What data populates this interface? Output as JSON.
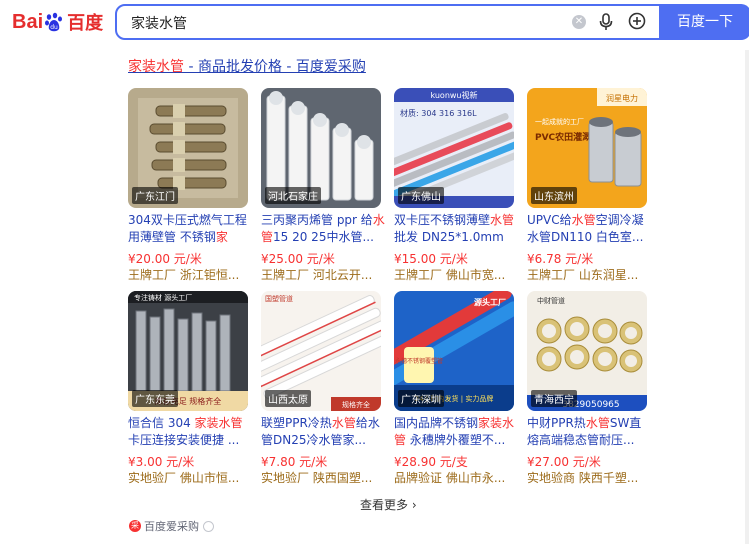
{
  "header": {
    "logo_text": "Bai",
    "logo_text_cn": "百度",
    "search_value": "家装水管",
    "search_button": "百度一下"
  },
  "result": {
    "title_highlight": "家装水管",
    "title_rest": " - 商品批发价格 - 百度爱采购"
  },
  "products": [
    {
      "location": "广东江门",
      "title_a": "304双卡压式燃气工程用薄壁管 不锈钢",
      "title_hl": "家",
      "title_b": "",
      "price": "¥20.00 元/米",
      "seller": "王牌工厂 浙江钜恒..."
    },
    {
      "location": "河北石家庄",
      "title_a": "三丙聚丙烯管 ppr 给",
      "title_hl": "水管",
      "title_b": "15 20 25中水管...",
      "price": "¥25.00 元/米",
      "seller": "王牌工厂 河北云开..."
    },
    {
      "location": "广东佛山",
      "title_a": "双卡压不锈钢薄壁",
      "title_hl": "水管",
      "title_b": "批发 DN25*1.0mm ...",
      "price": "¥15.00 元/米",
      "seller": "王牌工厂 佛山市宽..."
    },
    {
      "location": "山东滨州",
      "title_a": "UPVC给",
      "title_hl": "水管",
      "title_b": "空调冷凝水管DN110 白色室...",
      "price": "¥6.78 元/米",
      "seller": "王牌工厂 山东润星..."
    },
    {
      "location": "广东东莞",
      "title_a": "恒合信 304 ",
      "title_hl": "家装水管",
      "title_b": "卡压连接安装便捷 ...",
      "price": "¥3.00 元/米",
      "seller": "实地验厂 佛山市恒..."
    },
    {
      "location": "山西太原",
      "title_a": "联塑PPR冷热",
      "title_hl": "水管",
      "title_b": "给水管DN25冷水管家...",
      "price": "¥7.80 元/米",
      "seller": "实地验厂 陕西国塑..."
    },
    {
      "location": "广东深圳",
      "title_a": "国内品牌不锈钢",
      "title_hl": "家装水管",
      "title_b": " 永穗牌外覆塑不...",
      "price": "¥28.90 元/支",
      "seller": "品牌验证 佛山市永..."
    },
    {
      "location": "青海西宁",
      "title_a": "中财PPR热",
      "title_hl": "水管",
      "title_b": "SW直熔高端稳态管耐压...",
      "price": "¥27.00 元/米",
      "seller": "实地验商 陕西千塑..."
    }
  ],
  "more_label": "查看更多",
  "footer_label": "百度爱采购",
  "image_texts": {
    "p3_banner": "kuonwu视新",
    "p3_material": "材质: 304 316 316L",
    "p4_brand": "润星电力",
    "p4_main": "PVC农田灌溉管",
    "p4_sub": "一起成就的工厂",
    "p5_banner": "专注铸材 源头工厂",
    "p5_bottom": "库存充足 规格齐全",
    "p6_brand": "国塑管道",
    "p6_bottom": "规格齐全",
    "p7_a": "源头工厂",
    "p7_b": "永穗不锈钢覆塑管",
    "p7_c": "24小时内发货 | 实力品牌",
    "p8_phone": "3829050965",
    "p8_brand": "中财管道"
  },
  "colors": {
    "accent": "#4e6ef2",
    "link": "#2440b3",
    "highlight": "#f73131",
    "logo": "#e52e2e"
  }
}
